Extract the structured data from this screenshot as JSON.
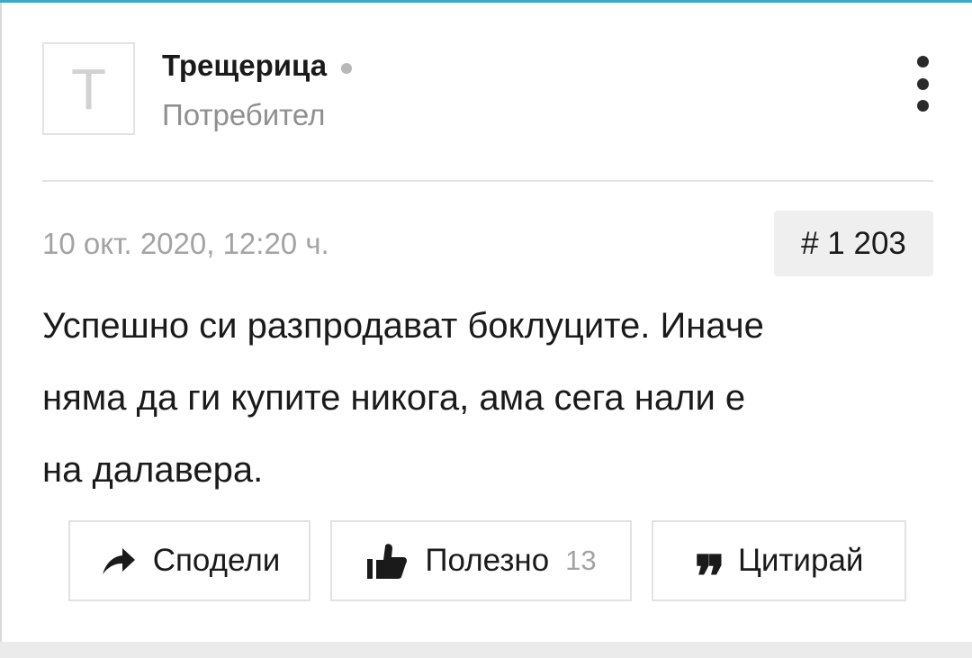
{
  "post": {
    "author": {
      "avatar_letter": "T",
      "name": "Трещерица",
      "role": "Потребител",
      "online_status": "offline",
      "online_dot_color": "#b7b7b7"
    },
    "timestamp": "10 окт. 2020, 12:20 ч.",
    "number": "# 1 203",
    "body_lines": [
      "Успешно си разпродават боклуците. Иначе",
      "няма да ги купите никога, ама сега нали е",
      "на далавера."
    ],
    "actions": {
      "share": {
        "label": "Сподели",
        "icon": "share-arrow-icon"
      },
      "like": {
        "label": "Полезно",
        "count": "13",
        "icon": "thumbs-up-icon"
      },
      "quote": {
        "label": "Цитирай",
        "glyph": "❞",
        "icon": "quote-icon"
      }
    },
    "menu_icon": "more-vertical-icon"
  },
  "colors": {
    "accent": "#3fa7c6",
    "text": "#1a1a1a",
    "muted": "#a3a3a3",
    "badge_bg": "#efefef",
    "border": "#e2e2e2"
  }
}
